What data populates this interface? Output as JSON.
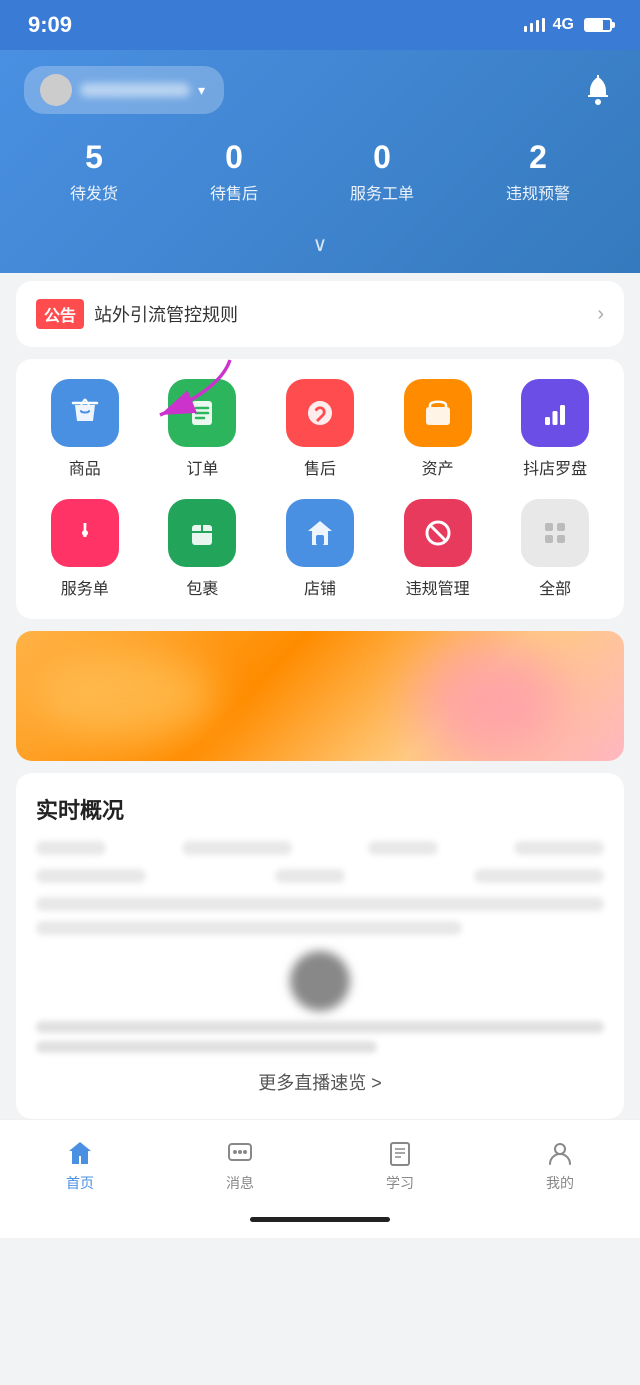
{
  "statusBar": {
    "time": "9:09",
    "signal": "4G"
  },
  "header": {
    "storeName": "店铺名称",
    "bellLabel": "通知",
    "stats": [
      {
        "number": "5",
        "label": "待发货"
      },
      {
        "number": "0",
        "label": "待售后"
      },
      {
        "number": "0",
        "label": "服务工单"
      },
      {
        "number": "2",
        "label": "违规预警"
      }
    ],
    "expandLabel": "展开"
  },
  "announcement": {
    "badge": "公告",
    "text": "站外引流管控规则",
    "arrowLabel": ">"
  },
  "menuItems": {
    "row1": [
      {
        "id": "goods",
        "label": "商品",
        "colorClass": "icon-blue",
        "icon": "🛍"
      },
      {
        "id": "orders",
        "label": "订单",
        "colorClass": "icon-green",
        "icon": "📋"
      },
      {
        "id": "aftersale",
        "label": "售后",
        "colorClass": "icon-red",
        "icon": "↩"
      },
      {
        "id": "assets",
        "label": "资产",
        "colorClass": "icon-orange",
        "icon": "📦"
      },
      {
        "id": "compass",
        "label": "抖店罗盘",
        "colorClass": "icon-purple",
        "icon": "📊"
      }
    ],
    "row2": [
      {
        "id": "service",
        "label": "服务单",
        "colorClass": "icon-pink",
        "icon": "!"
      },
      {
        "id": "package",
        "label": "包裹",
        "colorClass": "icon-darkgreen",
        "icon": "📫"
      },
      {
        "id": "shop",
        "label": "店铺",
        "colorClass": "icon-lightblue",
        "icon": "🏠"
      },
      {
        "id": "violation",
        "label": "违规管理",
        "colorClass": "icon-pinkred",
        "icon": "🚫"
      },
      {
        "id": "all",
        "label": "全部",
        "colorClass": "icon-gray",
        "icon": "⊞"
      }
    ]
  },
  "realtime": {
    "title": "实时概况",
    "moreLive": "更多直播速览 >"
  },
  "bottomNav": {
    "items": [
      {
        "id": "home",
        "label": "首页",
        "active": true
      },
      {
        "id": "messages",
        "label": "消息",
        "active": false
      },
      {
        "id": "learning",
        "label": "学习",
        "active": false
      },
      {
        "id": "mine",
        "label": "我的",
        "active": false
      }
    ]
  }
}
